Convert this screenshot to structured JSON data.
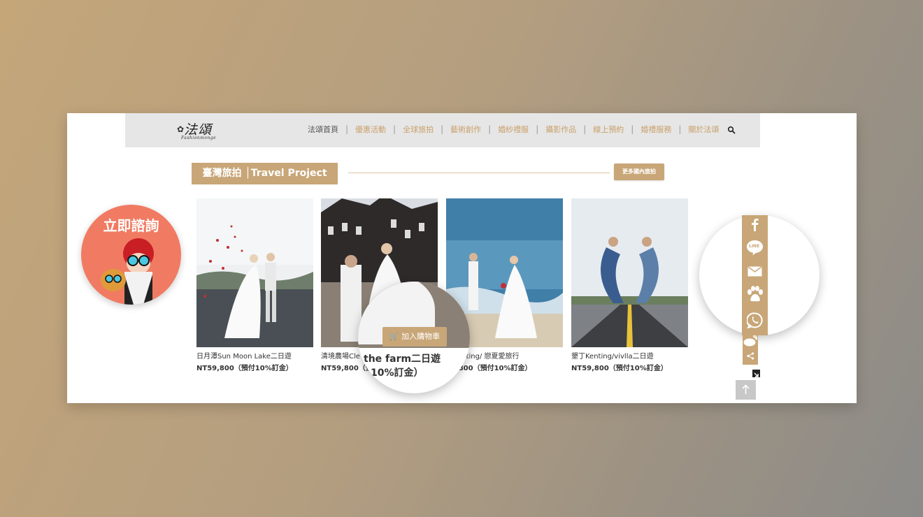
{
  "logo": {
    "main": "法頌",
    "sub": "Fashionmonge"
  },
  "nav": {
    "items": [
      "法頌首頁",
      "優惠活動",
      "全球旅拍",
      "藝術創作",
      "婚紗禮服",
      "攝影作品",
      "線上預約",
      "婚禮服務",
      "關於法頌"
    ],
    "separator": "|"
  },
  "section": {
    "title": "臺灣旅拍 │Travel Project",
    "more_label": "更多國內旅拍"
  },
  "products": [
    {
      "title": "日月潭Sun Moon Lake二日遊",
      "price": "NT59,800（預付10%訂金）"
    },
    {
      "title": "清境農場Cle",
      "price": "NT59,800（預"
    },
    {
      "title": "墾Kenting/ 戀夏愛旅行",
      "price": "59,800（預付10%訂金）"
    },
    {
      "title": "墾丁Kenting/vivlla二日遊",
      "price": "NT59,800（預付10%訂金）"
    }
  ],
  "zoom": {
    "cart_label": "加入購物車",
    "title": "the farm二日遊",
    "price": "10%訂金）"
  },
  "consult": {
    "label": "立即諮詢"
  },
  "share": {
    "line_label": "LINE"
  },
  "colors": {
    "accent": "#c8a677",
    "consult_bg": "#f07b62",
    "nav_bg": "#e6e6e6"
  }
}
